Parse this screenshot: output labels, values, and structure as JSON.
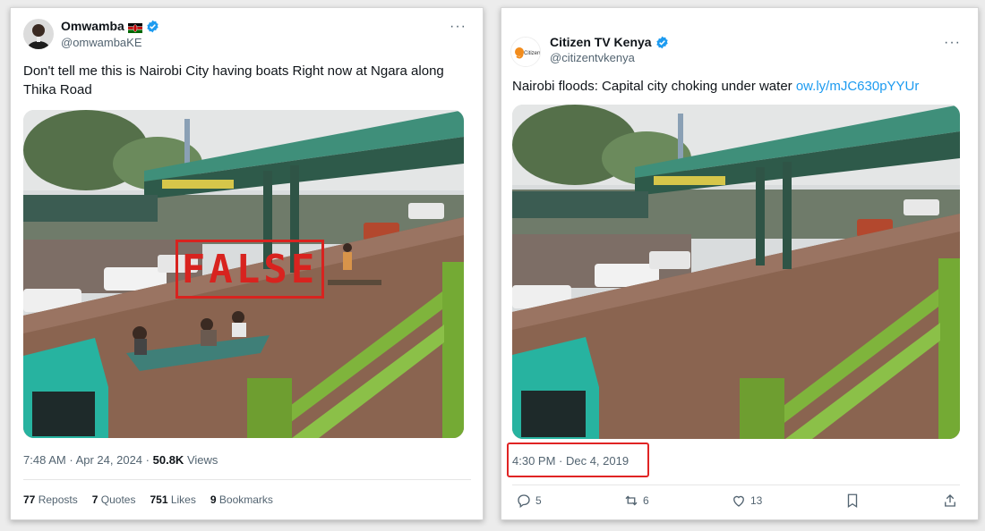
{
  "left_tweet": {
    "display_name": "Omwamba",
    "handle": "@omwambaKE",
    "text": "Don't tell me this is Nairobi City having boats Right now at Ngara along Thika Road",
    "stamp": "FALSE",
    "time": "7:48 AM",
    "date": "Apr 24, 2024",
    "views_count": "50.8K",
    "views_label": "Views",
    "stats": [
      {
        "count": "77",
        "label": "Reposts"
      },
      {
        "count": "7",
        "label": "Quotes"
      },
      {
        "count": "751",
        "label": "Likes"
      },
      {
        "count": "9",
        "label": "Bookmarks"
      }
    ]
  },
  "right_tweet": {
    "display_name": "Citizen TV Kenya",
    "handle": "@citizentvkenya",
    "avatar_text": "Citizen",
    "text": "Nairobi floods: Capital city choking under water",
    "link": "ow.ly/mJC630pYYUr",
    "timestamp": "4:30 PM · Dec 4, 2019",
    "actions": {
      "replies": "5",
      "reposts": "6",
      "likes": "13"
    }
  },
  "colors": {
    "verified": "#1d9bf0",
    "highlight": "#e02424",
    "stamp": "#d8231f",
    "water": "#8a6450",
    "bridge_roof": "#3f8f7a",
    "railing": "#7fb43c"
  },
  "icons": [
    "more-icon",
    "verified-icon",
    "kenya-flag-icon",
    "reply-icon",
    "repost-icon",
    "like-icon",
    "bookmark-icon",
    "share-icon"
  ]
}
